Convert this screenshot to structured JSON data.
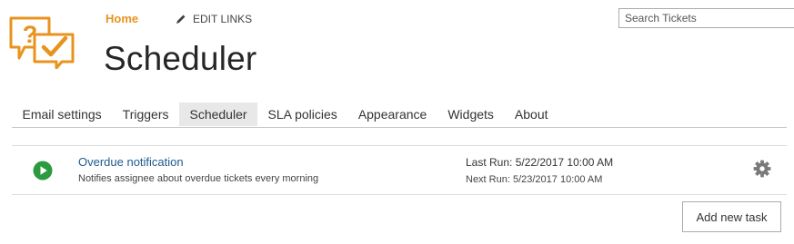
{
  "header": {
    "home_label": "Home",
    "edit_links_label": "EDIT LINKS",
    "page_title": "Scheduler",
    "search": {
      "placeholder": "Search Tickets",
      "value": ""
    }
  },
  "icons": {
    "logo": "chat-question-check-logo",
    "edit": "pencil-icon",
    "run": "play-icon",
    "settings": "gear-icon"
  },
  "colors": {
    "accent": "#e8931e",
    "link": "#1f5a8e",
    "run_green": "#2c9a3f",
    "active_tab_bg": "#e8e8e8",
    "gear_gray": "#7a7a7a"
  },
  "tabs": [
    {
      "label": "Email settings",
      "active": false
    },
    {
      "label": "Triggers",
      "active": false
    },
    {
      "label": "Scheduler",
      "active": true
    },
    {
      "label": "SLA policies",
      "active": false
    },
    {
      "label": "Appearance",
      "active": false
    },
    {
      "label": "Widgets",
      "active": false
    },
    {
      "label": "About",
      "active": false
    }
  ],
  "tasks": [
    {
      "name": "Overdue notification",
      "description": "Notifies assignee about overdue tickets every morning",
      "last_run": "Last Run: 5/22/2017 10:00 AM",
      "next_run": "Next Run: 5/23/2017 10:00 AM"
    }
  ],
  "actions": {
    "add_task_label": "Add new task"
  }
}
